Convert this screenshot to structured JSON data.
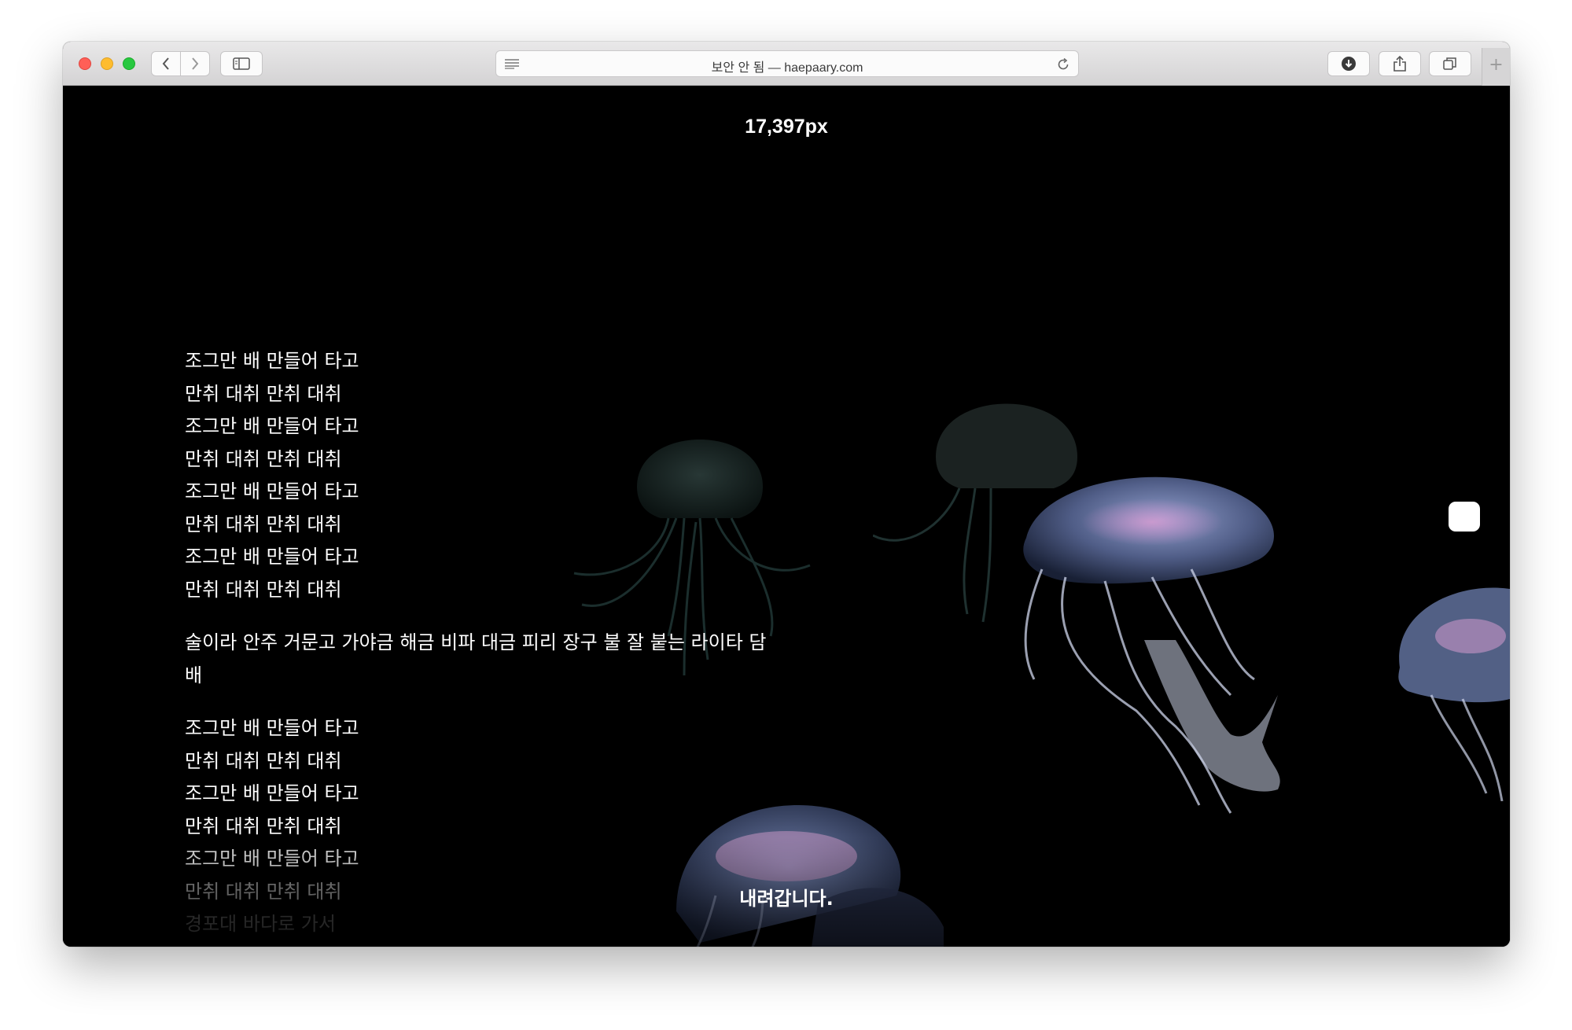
{
  "browser": {
    "url_display": "보안 안 됨 — haepaary.com",
    "icons": {
      "back": "chevron-left-icon",
      "forward": "chevron-right-icon",
      "sidebar": "sidebar-icon",
      "reader": "reader-lines-icon",
      "reload": "reload-icon",
      "download": "download-icon",
      "share": "share-icon",
      "tabs": "tabs-overview-icon",
      "newtab": "plus-icon"
    }
  },
  "page": {
    "scroll_counter": "17,397px",
    "lyrics_group1": [
      "조그만 배 만들어 타고",
      "만취 대취 만취 대취",
      "조그만 배 만들어 타고",
      "만취 대취 만취 대취",
      "조그만 배 만들어 타고",
      "만취 대취 만취 대취",
      "조그만 배 만들어 타고",
      "만취 대취 만취 대취"
    ],
    "lyrics_paragraph": "술이라 안주 거문고 가야금 해금 비파 대금 피리 장구 불 잘 붙는 라이타 담배",
    "lyrics_group2": [
      "조그만 배 만들어 타고",
      "만취 대취 만취 대취",
      "조그만 배 만들어 타고",
      "만취 대취 만취 대취",
      "조그만 배 만들어 타고",
      "만취 대취 만취 대취",
      "경포대 바다로 가서"
    ],
    "down_label": "내려갑니다.",
    "colors": {
      "background": "#000000",
      "text": "#ffffff",
      "jelly_body": "#b8c8e8",
      "jelly_pink": "#c890c0"
    }
  }
}
